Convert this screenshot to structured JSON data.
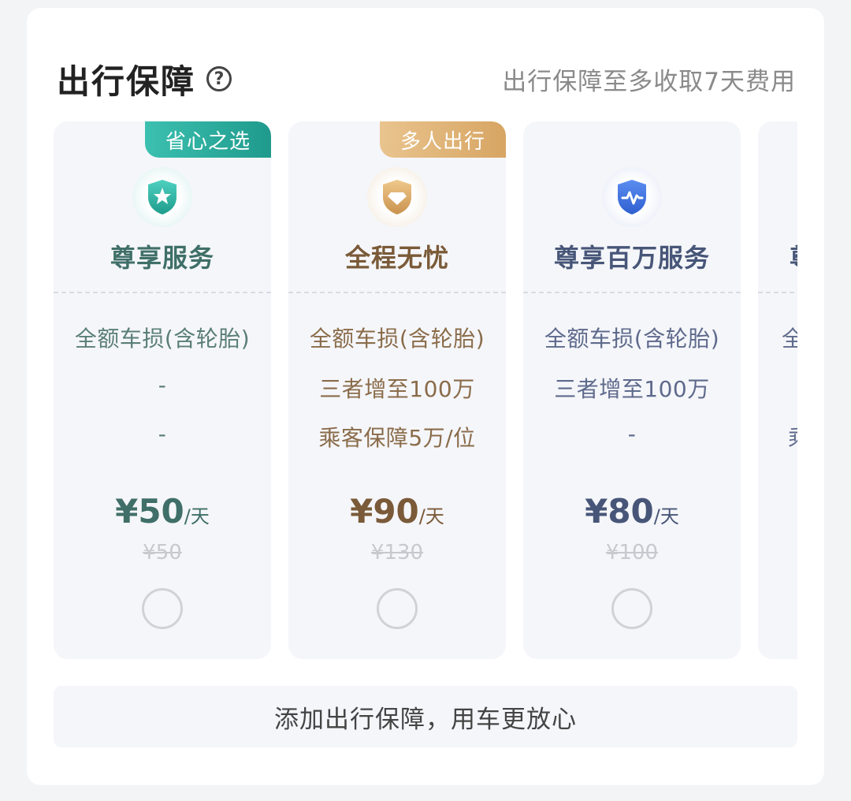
{
  "header": {
    "title": "出行保障",
    "help_icon": "?",
    "note": "出行保障至多收取7天费用"
  },
  "plans": [
    {
      "badge": "省心之选",
      "badge_color": "#2aa89a",
      "icon": "shield-star-icon",
      "name": "尊享服务",
      "features": [
        "全额车损(含轮胎)",
        "-",
        "-"
      ],
      "price": "¥50",
      "unit": "/天",
      "original_price": "¥50",
      "selected": false
    },
    {
      "badge": "多人出行",
      "badge_color": "#d9ac6e",
      "icon": "shield-diamond-icon",
      "name": "全程无忧",
      "features": [
        "全额车损(含轮胎)",
        "三者增至100万",
        "乘客保障5万/位"
      ],
      "price": "¥90",
      "unit": "/天",
      "original_price": "¥130",
      "selected": false
    },
    {
      "badge": "",
      "icon": "shield-pulse-icon",
      "name": "尊享百万服务",
      "features": [
        "全额车损(含轮胎)",
        "三者增至100万",
        "-"
      ],
      "price": "¥80",
      "unit": "/天",
      "original_price": "¥100",
      "selected": false
    },
    {
      "badge": "",
      "icon": "",
      "name": "尊",
      "features": [
        "全",
        "",
        "乘"
      ],
      "price": "",
      "unit": "",
      "original_price": "",
      "selected": false
    }
  ],
  "footer": {
    "text": "添加出行保障，用车更放心"
  }
}
